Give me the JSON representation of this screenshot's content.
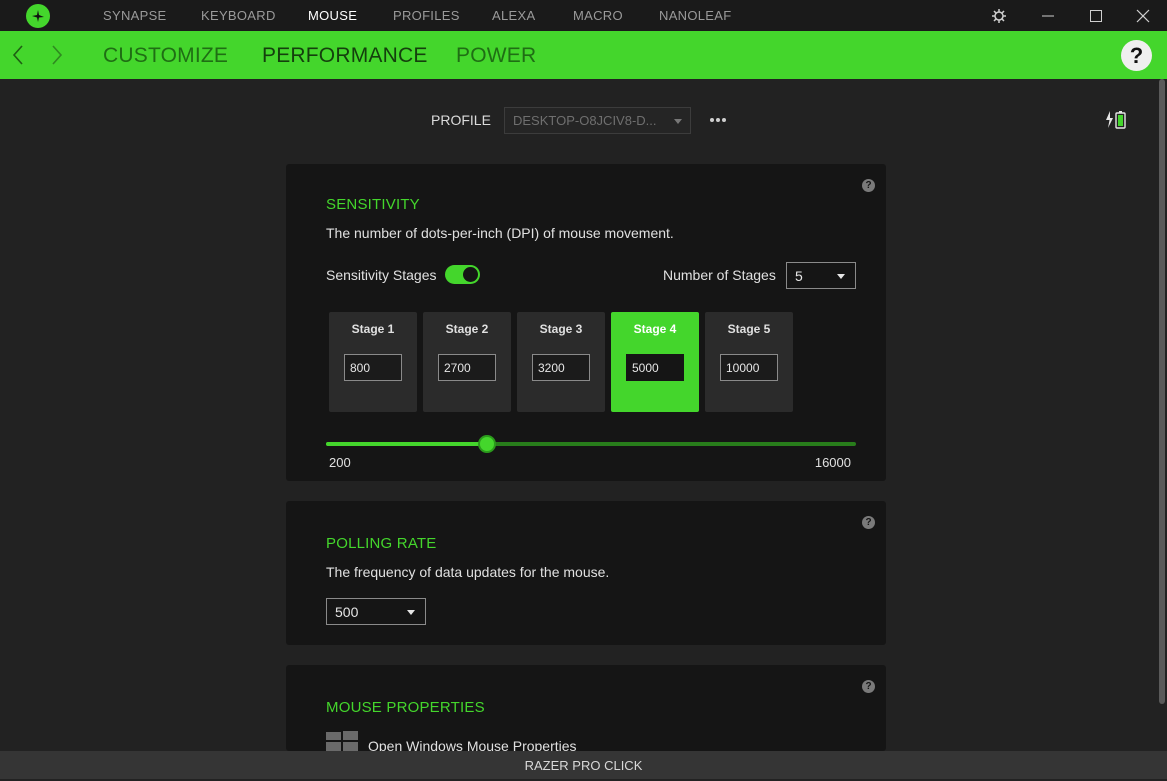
{
  "topnav": {
    "items": [
      "SYNAPSE",
      "KEYBOARD",
      "MOUSE",
      "PROFILES",
      "ALEXA",
      "MACRO",
      "NANOLEAF"
    ],
    "active": "MOUSE"
  },
  "subnav": {
    "tabs": [
      "CUSTOMIZE",
      "PERFORMANCE",
      "POWER"
    ],
    "active": "PERFORMANCE",
    "help": "?"
  },
  "profile": {
    "label": "PROFILE",
    "value": "DESKTOP-O8JCIV8-D..."
  },
  "sensitivity": {
    "title": "SENSITIVITY",
    "description": "The number of dots-per-inch (DPI) of mouse movement.",
    "stages_toggle_label": "Sensitivity Stages",
    "stages_enabled": true,
    "num_stages_label": "Number of Stages",
    "num_stages": "5",
    "active_stage": 4,
    "stages": [
      {
        "label": "Stage 1",
        "value": "800"
      },
      {
        "label": "Stage 2",
        "value": "2700"
      },
      {
        "label": "Stage 3",
        "value": "3200"
      },
      {
        "label": "Stage 4",
        "value": "5000"
      },
      {
        "label": "Stage 5",
        "value": "10000"
      }
    ],
    "slider_min": "200",
    "slider_max": "16000",
    "slider_value": 5000
  },
  "polling": {
    "title": "POLLING RATE",
    "description": "The frequency of data updates for the mouse.",
    "value": "500"
  },
  "mouse_properties": {
    "title": "MOUSE PROPERTIES",
    "link": "Open Windows Mouse Properties"
  },
  "device": "RAZER PRO CLICK",
  "colors": {
    "accent": "#44d62c",
    "background": "#222222",
    "panel": "#151515"
  }
}
